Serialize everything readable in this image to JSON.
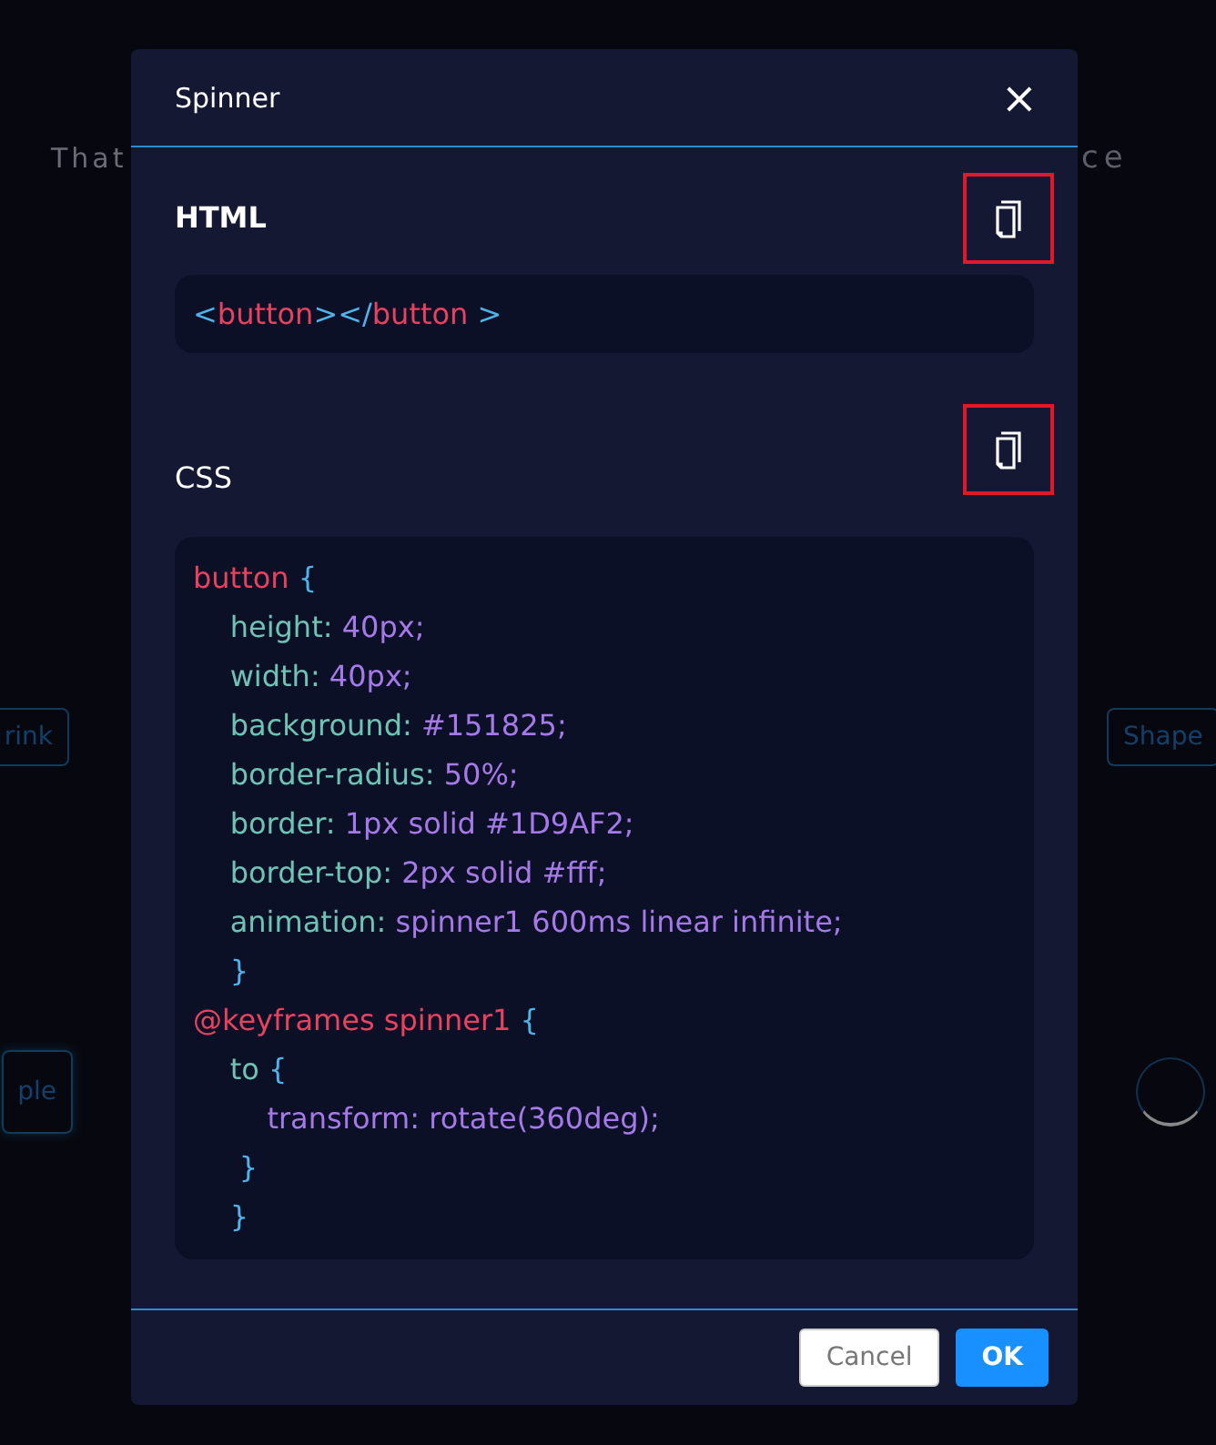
{
  "background": {
    "tagline_left": "That",
    "tagline_right": "ce",
    "buttons": [
      {
        "label": "rink"
      },
      {
        "label": "Shape"
      },
      {
        "label": "ple"
      }
    ]
  },
  "dialog": {
    "title": "Spinner",
    "close": "×",
    "sections": [
      {
        "label": "HTML",
        "lines": [
          [
            {
              "t": "<",
              "kind": "punct"
            },
            {
              "t": "button",
              "kind": "tag"
            },
            {
              "t": "></",
              "kind": "punct"
            },
            {
              "t": "button",
              "kind": "tag"
            },
            {
              "t": " >",
              "kind": "punct"
            }
          ]
        ]
      },
      {
        "label": "CSS",
        "lines": [
          [
            {
              "t": "button ",
              "kind": "tag"
            },
            {
              "t": "{",
              "kind": "punct"
            }
          ],
          [
            {
              "t": "    height: ",
              "kind": "prop"
            },
            {
              "t": "40px;",
              "kind": "value"
            }
          ],
          [
            {
              "t": "    width: ",
              "kind": "prop"
            },
            {
              "t": "40px;",
              "kind": "value"
            }
          ],
          [
            {
              "t": "    background: ",
              "kind": "prop"
            },
            {
              "t": "#151825;",
              "kind": "value"
            }
          ],
          [
            {
              "t": "    border-radius: ",
              "kind": "prop"
            },
            {
              "t": "50%;",
              "kind": "value"
            }
          ],
          [
            {
              "t": "    border: ",
              "kind": "prop"
            },
            {
              "t": "1px solid #1D9AF2;",
              "kind": "value"
            }
          ],
          [
            {
              "t": "    border-top: ",
              "kind": "prop"
            },
            {
              "t": "2px solid #fff;",
              "kind": "value"
            }
          ],
          [
            {
              "t": "    animation: ",
              "kind": "prop"
            },
            {
              "t": "spinner1 600ms linear infinite;",
              "kind": "value"
            }
          ],
          [
            {
              "t": "    }",
              "kind": "punct"
            }
          ],
          [
            {
              "t": "@keyframes spinner1 ",
              "kind": "tag"
            },
            {
              "t": "{",
              "kind": "punct"
            }
          ],
          [
            {
              "t": "    to ",
              "kind": "prop"
            },
            {
              "t": "{",
              "kind": "punct"
            }
          ],
          [
            {
              "t": "        transform: rotate(360deg);",
              "kind": "value"
            }
          ],
          [
            {
              "t": "     }",
              "kind": "punct"
            }
          ],
          [
            {
              "t": "    }",
              "kind": "punct"
            }
          ]
        ]
      }
    ],
    "buttons": [
      {
        "label": "Cancel",
        "kind": "secondary"
      },
      {
        "label": "OK",
        "kind": "primary"
      }
    ]
  }
}
